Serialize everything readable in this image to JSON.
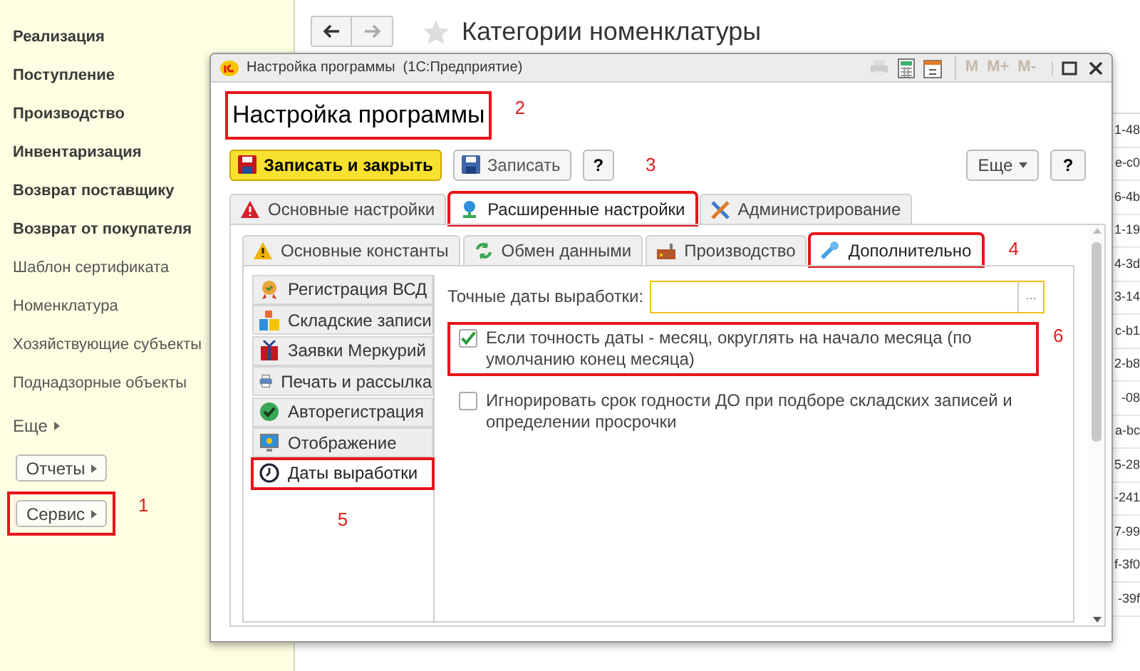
{
  "sidebar": {
    "items": [
      {
        "label": "Реализация",
        "bold": true
      },
      {
        "label": "Поступление",
        "bold": true
      },
      {
        "label": "Производство",
        "bold": true
      },
      {
        "label": "Инвентаризация",
        "bold": true
      },
      {
        "label": "Возврат поставщику",
        "bold": true
      },
      {
        "label": "Возврат от покупателя",
        "bold": true
      },
      {
        "label": "Шаблон сертификата",
        "bold": false
      },
      {
        "label": "Номенклатура",
        "bold": false
      },
      {
        "label": "Хозяйствующие субъекты",
        "bold": false
      },
      {
        "label": "Поднадзорные объекты",
        "bold": false
      }
    ],
    "more": "Еще",
    "buttons": [
      {
        "label": "Отчеты",
        "highlighted": false
      },
      {
        "label": "Сервис",
        "highlighted": true,
        "annotation": "1"
      }
    ]
  },
  "main": {
    "title": "Категории номенклатуры",
    "table": {
      "column_cut": [
        "1-48",
        "e-c0",
        "6-4b",
        "1-19",
        "4-3d",
        "3-14",
        "c-b1",
        "2-b8",
        "-08",
        "a-bc",
        "5-28",
        "-241",
        "7-99",
        "f-3f0",
        "-39f"
      ]
    }
  },
  "dialog": {
    "title": "Настройка программы  (1С:Предприятие)",
    "heading": {
      "text": "Настройка программы",
      "highlighted": true,
      "annotation": "2"
    },
    "toolbar": {
      "primary": "Записать и закрыть",
      "save": "Записать",
      "help": "?",
      "annotation": "3",
      "more": "Еще",
      "help_right": "?"
    },
    "title_buttons": [
      "M",
      "M+",
      "M-"
    ],
    "tabs": [
      {
        "label": "Основные настройки",
        "selected": false,
        "highlighted": false
      },
      {
        "label": "Расширенные настройки",
        "selected": true,
        "highlighted": true
      },
      {
        "label": "Администрирование",
        "selected": false,
        "highlighted": false
      }
    ],
    "subtabs": [
      {
        "label": "Основные константы",
        "selected": false,
        "highlighted": false
      },
      {
        "label": "Обмен данными",
        "selected": false,
        "highlighted": false
      },
      {
        "label": "Производство",
        "selected": false,
        "highlighted": false
      },
      {
        "label": "Дополнительно",
        "selected": true,
        "highlighted": true,
        "annotation": "4"
      }
    ],
    "sections": [
      {
        "label": "Регистрация ВСД",
        "selected": false,
        "highlighted": false
      },
      {
        "label": "Складские записи",
        "selected": false,
        "highlighted": false
      },
      {
        "label": "Заявки Меркурий",
        "selected": false,
        "highlighted": false
      },
      {
        "label": "Печать и рассылка",
        "selected": false,
        "highlighted": false
      },
      {
        "label": "Авторегистрация",
        "selected": false,
        "highlighted": false
      },
      {
        "label": "Отображение",
        "selected": false,
        "highlighted": false
      },
      {
        "label": "Даты выработки",
        "selected": true,
        "highlighted": true
      }
    ],
    "sections_annotation": "5",
    "field": {
      "label": "Точные даты выработки:",
      "button": "..."
    },
    "options": [
      {
        "label": "Если точность даты - месяц, округлять на начало месяца (по умолчанию конец месяца)",
        "checked": true,
        "highlighted": true,
        "annotation": "6"
      },
      {
        "label": "Игнорировать срок годности ДО при подборе складских записей и определении просрочки",
        "checked": false,
        "highlighted": false
      }
    ]
  }
}
